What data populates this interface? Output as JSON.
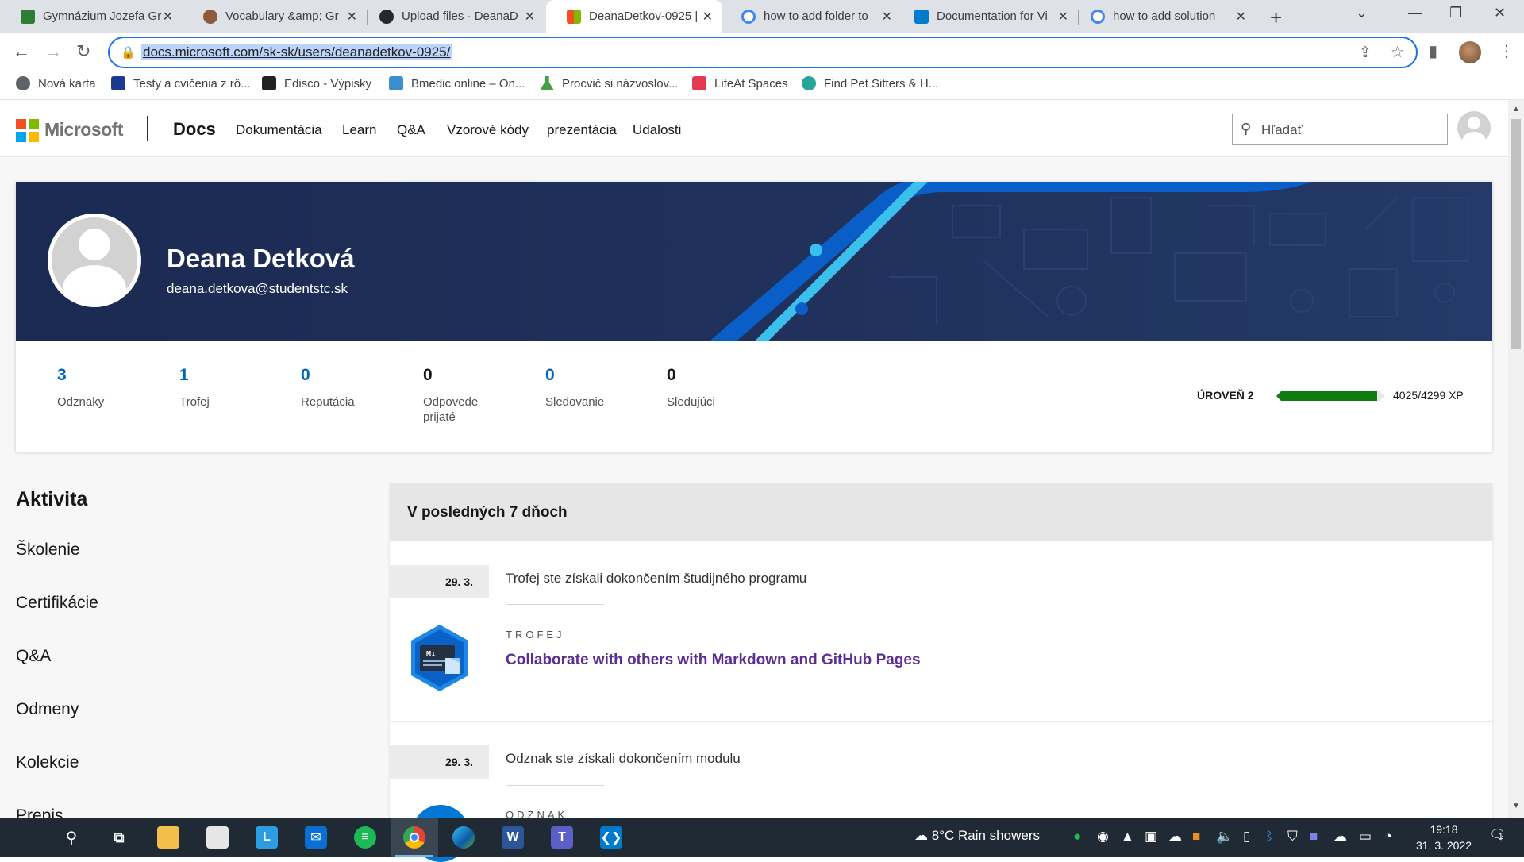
{
  "browser": {
    "tabs": [
      {
        "title": "Gymnázium Jozefa Gr",
        "favicon_color": "#2e7d32"
      },
      {
        "title": "Vocabulary &amp; Gr",
        "favicon_color": "#8d5a3b"
      },
      {
        "title": "Upload files · DeanaD",
        "favicon_color": "#24292f"
      },
      {
        "title": "DeanaDetkov-0925 | ",
        "favicon_color": "#f25022"
      },
      {
        "title": "how to add folder to",
        "favicon_color": "#4285f4"
      },
      {
        "title": "Documentation for Vi",
        "favicon_color": "#007acc"
      },
      {
        "title": "how to add solution",
        "favicon_color": "#4285f4"
      }
    ],
    "active_tab_index": 3,
    "url": "docs.microsoft.com/sk-sk/users/deanadetkov-0925/"
  },
  "bookmarks": [
    {
      "label": "Nová karta",
      "color": "#5f6368"
    },
    {
      "label": "Testy a cvičenia z rô...",
      "color": "#1a3a8f"
    },
    {
      "label": "Edisco - Výpisky",
      "color": "#222222"
    },
    {
      "label": "Bmedic online – On...",
      "color": "#3b8fcf"
    },
    {
      "label": "Procvič si názvoslov...",
      "color": "#43a047"
    },
    {
      "label": "LifeAt Spaces",
      "color": "#e53950"
    },
    {
      "label": "Find Pet Sitters & H...",
      "color": "#26a69a"
    }
  ],
  "header": {
    "brand": "Microsoft",
    "product": "Docs",
    "nav": [
      "Dokumentácia",
      "Learn",
      "Q&A",
      "Vzorové kódy",
      "prezentácia",
      "Udalosti"
    ],
    "search_placeholder": "Hľadať"
  },
  "profile": {
    "name": "Deana Detková",
    "email": "deana.detkova@studentstc.sk",
    "stats": [
      {
        "value": "3",
        "label": "Odznaky",
        "color": "#0065b3"
      },
      {
        "value": "1",
        "label": "Trofej",
        "color": "#0065b3"
      },
      {
        "value": "0",
        "label": "Reputácia",
        "color": "#0065b3"
      },
      {
        "value": "0",
        "label": "Odpovede prijaté",
        "color": "#171717"
      },
      {
        "value": "0",
        "label": "Sledovanie",
        "color": "#0065b3"
      },
      {
        "value": "0",
        "label": "Sledujúci",
        "color": "#171717"
      }
    ],
    "level": "ÚROVEŇ 2",
    "xp_text": "4025/4299 XP",
    "xp_fraction": 0.936
  },
  "sidebar": {
    "title": "Aktivita",
    "items": [
      "Školenie",
      "Certifikácie",
      "Q&A",
      "Odmeny",
      "Kolekcie",
      "Prepis"
    ]
  },
  "feed": {
    "heading": "V posledných 7 dňoch",
    "items": [
      {
        "date": "29. 3.",
        "description": "Trofej ste získali dokončením študijného programu",
        "kind": "TROFEJ",
        "title": "Collaborate with others with Markdown and GitHub Pages"
      },
      {
        "date": "29. 3.",
        "description": "Odznak ste získali dokončením modulu",
        "kind": "ODZNAK",
        "title": ""
      }
    ]
  },
  "taskbar": {
    "weather": "8°C  Rain showers",
    "time": "19:18",
    "date": "31. 3. 2022",
    "notification_count": "1"
  }
}
